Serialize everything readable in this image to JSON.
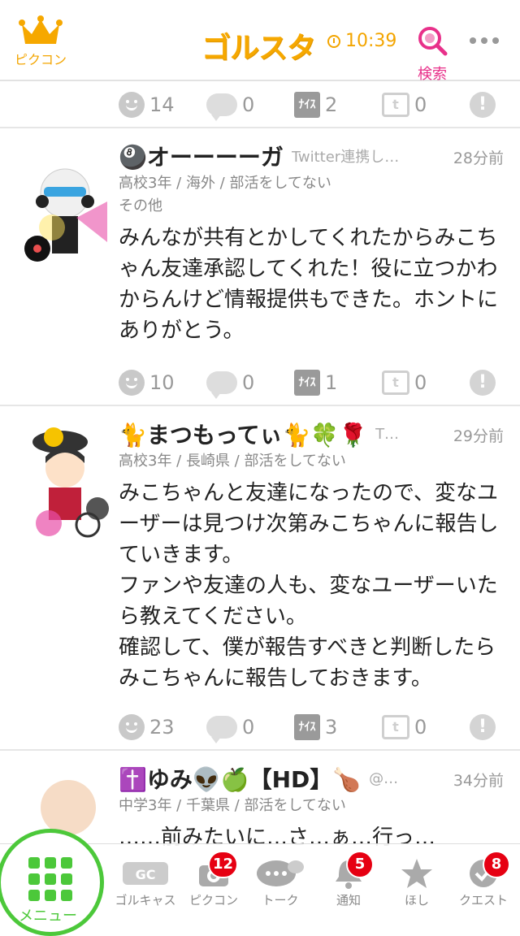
{
  "header": {
    "left_label": "ピクコン",
    "logo": "ゴルスタ",
    "time": "10:39",
    "search_label": "検索"
  },
  "top_actions": {
    "likes": "14",
    "comments": "0",
    "nice": "2",
    "twitter": "0"
  },
  "posts": [
    {
      "name": "🎱オーーーーガ",
      "source": "Twitter連携し…",
      "time": "28分前",
      "meta1": "高校3年 / 海外 / 部活をしてない",
      "meta2": "その他",
      "text": "みんなが共有とかしてくれたからみこちゃん友達承認してくれた！役に立つかわからんけど情報提供もできた。ホントにありがとう。",
      "likes": "10",
      "comments": "0",
      "nice": "1",
      "twitter": "0"
    },
    {
      "name": "🐈まつもってぃ🐈🍀🌹",
      "source": "T…",
      "time": "29分前",
      "meta1": "高校3年 / 長崎県 / 部活をしてない",
      "meta2": "",
      "text": "みこちゃんと友達になったので、変なユーザーは見つけ次第みこちゃんに報告していきます。\nファンや友達の人も、変なユーザーいたら教えてください。\n確認して、僕が報告すべきと判断したらみこちゃんに報告しておきます。",
      "likes": "23",
      "comments": "0",
      "nice": "3",
      "twitter": "0"
    },
    {
      "name": "✝️ゆみ👽🍏【HD】🍗",
      "source": "@…",
      "time": "34分前",
      "meta1": "中学3年 / 千葉県 / 部活をしてない",
      "meta2": "",
      "text": "……前みたいに…さ…ぁ…行っ…",
      "likes": "",
      "comments": "",
      "nice": "",
      "twitter": ""
    }
  ],
  "icons": {
    "nice": "ﾅｲｽ",
    "twitter": "t",
    "report": "!"
  },
  "tabbar": {
    "menu_label": "メニュー",
    "tabs": [
      {
        "label": "ゴルキャス",
        "badge": ""
      },
      {
        "label": "ピクコン",
        "badge": "12"
      },
      {
        "label": "トーク",
        "badge": ""
      },
      {
        "label": "通知",
        "badge": "5"
      },
      {
        "label": "ほし",
        "badge": ""
      },
      {
        "label": "クエスト",
        "badge": "8"
      }
    ]
  },
  "colors": {
    "brand": "#f6a800",
    "accent": "#e8308a",
    "menu_green": "#4cc83a",
    "badge": "#e60012"
  }
}
